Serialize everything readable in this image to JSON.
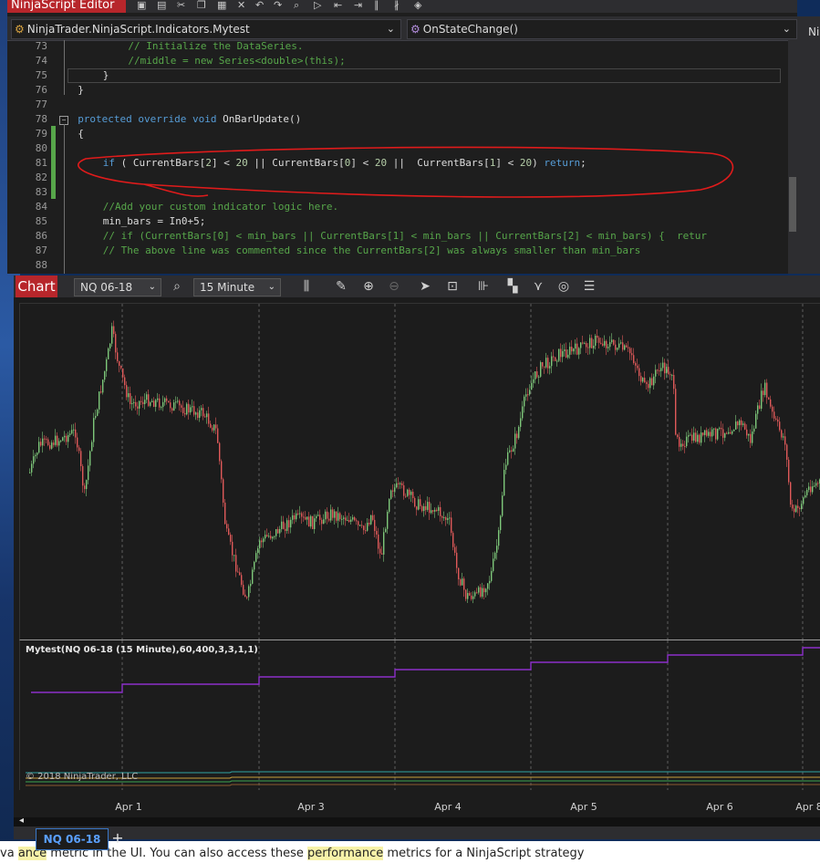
{
  "editor": {
    "title": "NinjaScript Editor",
    "type_combo": "NinjaTrader.NinjaScript.Indicators.Mytest",
    "member_combo": "OnStateChange()",
    "right_pane_text": "Ni",
    "lines": [
      {
        "n": "73",
        "indent": 16,
        "parts": [
          {
            "t": "// Initialize the DataSeries.",
            "c": "cm"
          }
        ]
      },
      {
        "n": "74",
        "indent": 16,
        "parts": [
          {
            "t": "//middle = new Series<double>(this);",
            "c": "cm"
          }
        ]
      },
      {
        "n": "75",
        "indent": 12,
        "parts": [
          {
            "t": "}",
            "c": ""
          }
        ]
      },
      {
        "n": "76",
        "indent": 8,
        "parts": [
          {
            "t": "}",
            "c": ""
          }
        ]
      },
      {
        "n": "77",
        "indent": 0,
        "parts": []
      },
      {
        "n": "78",
        "indent": 8,
        "parts": [
          {
            "t": "protected override void",
            "c": "kw"
          },
          {
            "t": " OnBarUpdate()",
            "c": ""
          }
        ]
      },
      {
        "n": "79",
        "indent": 8,
        "parts": [
          {
            "t": "{",
            "c": ""
          }
        ]
      },
      {
        "n": "80",
        "indent": 0,
        "parts": []
      },
      {
        "n": "81",
        "indent": 12,
        "parts": [
          {
            "t": "if",
            "c": "kw"
          },
          {
            "t": " ( CurrentBars[",
            "c": ""
          },
          {
            "t": "2",
            "c": "num"
          },
          {
            "t": "] < ",
            "c": ""
          },
          {
            "t": "20",
            "c": "num"
          },
          {
            "t": " || CurrentBars[",
            "c": ""
          },
          {
            "t": "0",
            "c": "num"
          },
          {
            "t": "] < ",
            "c": ""
          },
          {
            "t": "20",
            "c": "num"
          },
          {
            "t": " ||  CurrentBars[",
            "c": ""
          },
          {
            "t": "1",
            "c": "num"
          },
          {
            "t": "] < ",
            "c": ""
          },
          {
            "t": "20",
            "c": "num"
          },
          {
            "t": ") ",
            "c": ""
          },
          {
            "t": "return",
            "c": "kw"
          },
          {
            "t": ";",
            "c": ""
          }
        ]
      },
      {
        "n": "82",
        "indent": 0,
        "parts": []
      },
      {
        "n": "83",
        "indent": 0,
        "parts": []
      },
      {
        "n": "84",
        "indent": 12,
        "parts": [
          {
            "t": "//Add your custom indicator logic here.",
            "c": "cm"
          }
        ]
      },
      {
        "n": "85",
        "indent": 12,
        "parts": [
          {
            "t": "min_bars = In0+5;",
            "c": ""
          }
        ]
      },
      {
        "n": "86",
        "indent": 12,
        "parts": [
          {
            "t": "// if (CurrentBars[0] < min_bars || CurrentBars[1] < min_bars || CurrentBars[2] < min_bars) {  retur",
            "c": "cm"
          }
        ]
      },
      {
        "n": "87",
        "indent": 12,
        "parts": [
          {
            "t": "// The above line was commented since the CurrentBars[2] was always smaller than min_bars",
            "c": "cm"
          }
        ]
      },
      {
        "n": "88",
        "indent": 0,
        "parts": []
      }
    ]
  },
  "chart": {
    "label": "Chart",
    "instrument": "NQ 06-18",
    "interval": "15 Minute",
    "indicator_label": "Mytest(NQ 06-18 (15 Minute),60,400,3,3,1,1)",
    "copyright": "© 2018 NinjaTrader, LLC",
    "x_labels": [
      "Apr 1",
      "Apr 3",
      "Apr 4",
      "Apr 5",
      "Apr 6",
      "Apr 8"
    ],
    "tab": "NQ 06-18",
    "add_tab": "+",
    "colors": {
      "up": "#7ec87a",
      "down": "#e05a5a",
      "indicator": "#8b2fc9",
      "accent": "#b7262b"
    }
  },
  "background_page": {
    "pre": "va",
    "hl1": "ance",
    "mid": " metric in the UI. You can also access these ",
    "hl2": "performance",
    "post": " metrics for a NinjaScript strategy"
  }
}
